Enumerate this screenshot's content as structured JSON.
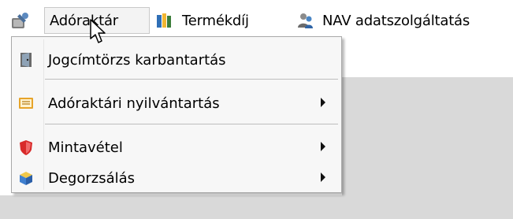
{
  "menubar": {
    "items": [
      {
        "label": "Adóraktár",
        "icon": "warehouse-icon"
      },
      {
        "label": "Termékdíj",
        "icon": "books-icon"
      },
      {
        "label": "NAV adatszolgáltatás",
        "icon": "users-icon"
      }
    ]
  },
  "dropdown": {
    "items": [
      {
        "label": "Jogcímtörzs karbantartás",
        "icon": "door-icon"
      },
      {
        "label": "Adóraktári nyilvántartás",
        "icon": "ledger-icon"
      },
      {
        "label": "Mintavétel",
        "icon": "shield-icon"
      },
      {
        "label": "Degorzsálás",
        "icon": "box-icon"
      }
    ]
  },
  "colors": {
    "menu_bg": "#f7f7f7",
    "highlight": "#f3f3f3",
    "gray_area": "#d9d9d9"
  }
}
